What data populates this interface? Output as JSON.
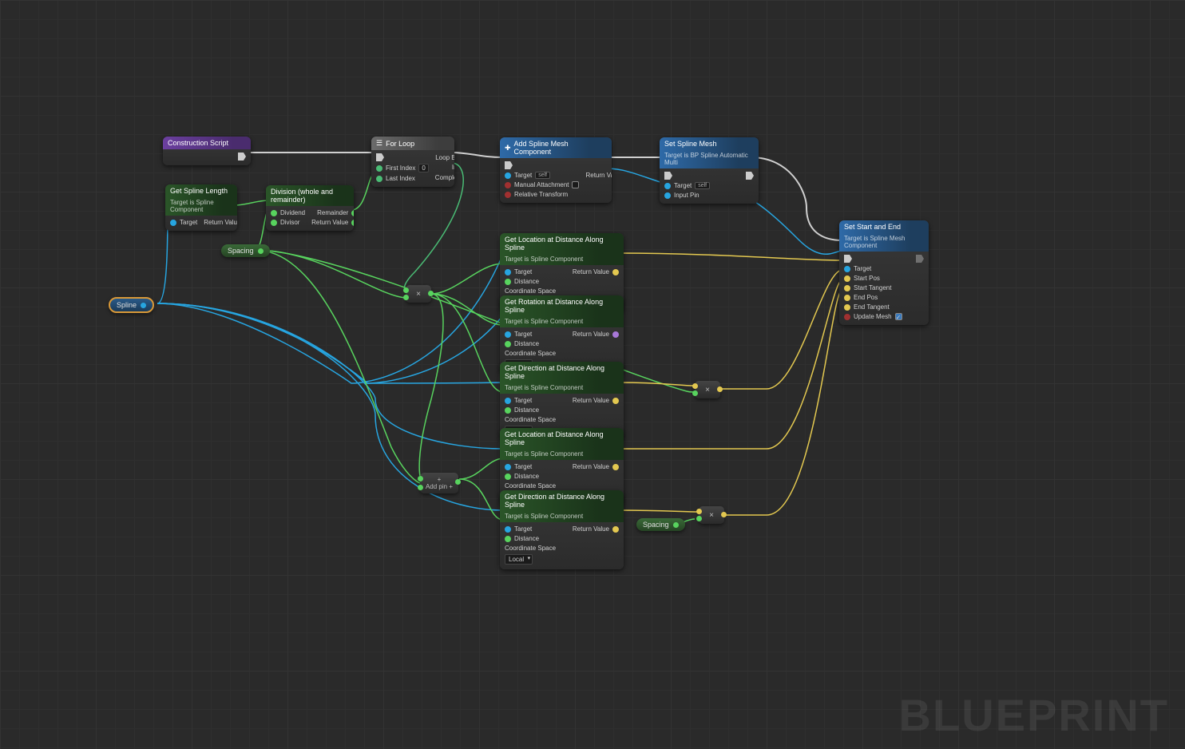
{
  "watermark": "BLUEPRINT",
  "nodes": {
    "construction": {
      "title": "Construction Script"
    },
    "forloop": {
      "title": "For Loop",
      "first_index": "First Index",
      "first_index_val": "0",
      "last_index": "Last Index",
      "loop_body": "Loop Body",
      "index": "Index",
      "completed": "Completed"
    },
    "add_smc": {
      "title": "Add Spline Mesh Component",
      "target": "Target",
      "self": "self",
      "manual": "Manual Attachment",
      "relative": "Relative Transform",
      "return": "Return Value"
    },
    "set_mesh": {
      "title": "Set Spline Mesh",
      "sub": "Target is BP Spline Automatic Multi",
      "target": "Target",
      "self": "self",
      "input_pin": "Input Pin"
    },
    "get_length": {
      "title": "Get Spline Length",
      "sub": "Target is Spline Component",
      "target": "Target",
      "return": "Return Value"
    },
    "division": {
      "title": "Division (whole and remainder)",
      "dividend": "Dividend",
      "divisor": "Divisor",
      "remainder": "Remainder",
      "return": "Return Value"
    },
    "spacing": "Spacing",
    "spline": "Spline",
    "get_loc": {
      "title": "Get Location at Distance Along Spline",
      "sub": "Target is Spline Component",
      "target": "Target",
      "distance": "Distance",
      "coord": "Coordinate Space",
      "coord_val": "Local",
      "return": "Return Value"
    },
    "get_rot": {
      "title": "Get Rotation at Distance Along Spline",
      "sub": "Target is Spline Component",
      "target": "Target",
      "distance": "Distance",
      "coord": "Coordinate Space",
      "coord_val": "Local",
      "return": "Return Value"
    },
    "get_dir": {
      "title": "Get Direction at Distance Along Spline",
      "sub": "Target is Spline Component",
      "target": "Target",
      "distance": "Distance",
      "coord": "Coordinate Space",
      "coord_val": "Local",
      "return": "Return Value"
    },
    "addpin": {
      "label": "Add pin",
      "icon": "+"
    },
    "set_se": {
      "title": "Set Start and End",
      "sub": "Target is Spline Mesh Component",
      "target": "Target",
      "start_pos": "Start Pos",
      "start_tan": "Start Tangent",
      "end_pos": "End Pos",
      "end_tan": "End Tangent",
      "update": "Update Mesh",
      "update_checked": true
    }
  }
}
